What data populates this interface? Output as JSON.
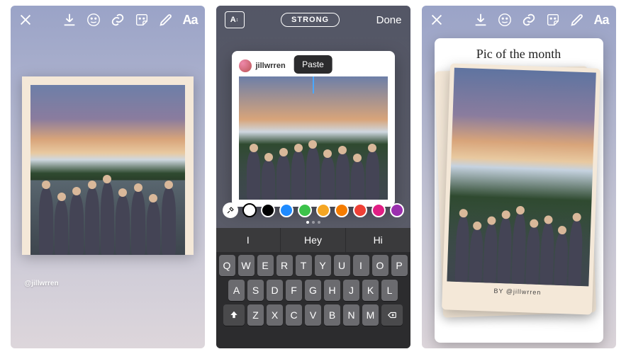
{
  "panel1": {
    "handle": "@jillwrren"
  },
  "panel2": {
    "font_style": "STRONG",
    "done_label": "Done",
    "username": "jillwrren",
    "paste_label": "Paste",
    "colors": [
      "#ffffff",
      "#000000",
      "#1f8bff",
      "#3cc24a",
      "#f5a623",
      "#f57c00",
      "#ef4036",
      "#e01e84",
      "#9b2fae"
    ],
    "suggestions": [
      "I",
      "Hey",
      "Hi"
    ],
    "keyboard": {
      "row1": [
        "Q",
        "W",
        "E",
        "R",
        "T",
        "Y",
        "U",
        "I",
        "O",
        "P"
      ],
      "row2": [
        "A",
        "S",
        "D",
        "F",
        "G",
        "H",
        "J",
        "K",
        "L"
      ],
      "row3": [
        "Z",
        "X",
        "C",
        "V",
        "B",
        "N",
        "M"
      ]
    }
  },
  "panel3": {
    "heading": "Pic of the month",
    "caption_prefix": "BY ",
    "caption_user": "@jillwrren"
  }
}
